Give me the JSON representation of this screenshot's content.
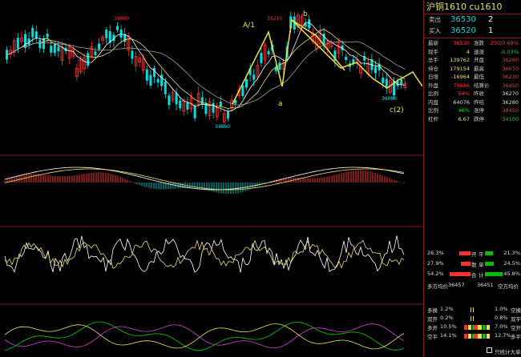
{
  "title": "沪铜1610  cu1610",
  "annotations": {
    "top_left_price": "39000",
    "peak_price": "39210",
    "low_price": "34860",
    "end_price": "36080",
    "wave_a1": "A/1",
    "wave_b": "b",
    "wave_a": "a",
    "wave_c2": "c(2)"
  },
  "orderbook": [
    {
      "label": "卖出",
      "price": "36530",
      "qty": "2"
    },
    {
      "label": "买入",
      "price": "36520",
      "qty": "1"
    }
  ],
  "quote": [
    {
      "l1": "最新",
      "v1": "36530",
      "c1": "red",
      "l2": "涨跌",
      "v2": "250/0.69%",
      "c2": "red"
    },
    {
      "l1": "现手",
      "v1": "4",
      "c1": "yel",
      "l2": "速涨",
      "v2": "-0.03%",
      "c2": "grn"
    },
    {
      "l1": "总手",
      "v1": "139762",
      "c1": "yel",
      "l2": "开盘",
      "v2": "36260",
      "c2": "red"
    },
    {
      "l1": "持仓",
      "v1": "179154",
      "c1": "yel",
      "l2": "最高",
      "v2": "36670",
      "c2": "red"
    },
    {
      "l1": "日增",
      "v1": "-16964",
      "c1": "yel",
      "l2": "最低",
      "v2": "36230",
      "c2": "red"
    },
    {
      "l1": "外盘",
      "v1": "75686",
      "c1": "red",
      "l2": "结算价",
      "v2": "36450",
      "c2": "red"
    },
    {
      "l1": "比例",
      "v1": "54%",
      "c1": "red",
      "l2": "昨收",
      "v2": "36270",
      "c2": "wht"
    },
    {
      "l1": "内盘",
      "v1": "64076",
      "c1": "wht",
      "l2": "昨结",
      "v2": "36280",
      "c2": "wht"
    },
    {
      "l1": "比例",
      "v1": "46%",
      "c1": "grn",
      "l2": "涨停",
      "v2": "38450",
      "c2": "red"
    },
    {
      "l1": "杠杆",
      "v1": "6.67",
      "c1": "yel",
      "l2": "跌停",
      "v2": "34100",
      "c2": "grn"
    }
  ],
  "ratios": [
    {
      "lp": "26.3%",
      "ll": "开",
      "rl": "平",
      "rp": "21.3%"
    },
    {
      "lp": "27.9%",
      "ll": "散",
      "rl": "单",
      "rp": "24.5%"
    },
    {
      "lp": "54.2%",
      "ll": "合",
      "rl": "计",
      "rp": "45.8%"
    }
  ],
  "avg": {
    "long_label": "多方均价",
    "long_value": "36457",
    "short_value": "36451",
    "short_label": "空方均价"
  },
  "flows": [
    {
      "l": "多换",
      "lp": "1.2%",
      "rp": "1.0%",
      "r": "空换"
    },
    {
      "l": "双开",
      "lp": "0.2%",
      "rp": "0.8%",
      "r": "双平"
    },
    {
      "l": "多开",
      "lp": "10.5%",
      "rp": "7.0%",
      "r": "空开"
    },
    {
      "l": "空平",
      "lp": "14.1%",
      "rp": "12.7%",
      "r": "多平"
    }
  ],
  "footer_label": "只统计大单",
  "colors": {
    "up": "#ff3030",
    "down": "#00e0e0",
    "ma1": "#ffffff",
    "ma2": "#f0e060",
    "ma3": "#a0a0a0",
    "wave": "#f0e040",
    "panel_border": "#8a1a1a"
  }
}
